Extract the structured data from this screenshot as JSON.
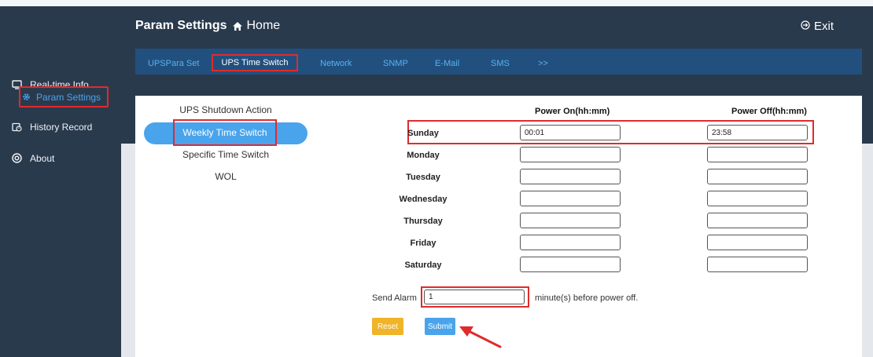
{
  "header": {
    "title": "Param Settings",
    "home_label": "Home",
    "exit_label": "Exit"
  },
  "sidebar": {
    "items": [
      {
        "label": "Real-time Info",
        "icon": "monitor-icon"
      },
      {
        "label": "Param Settings",
        "icon": "gear-icon",
        "active": true
      },
      {
        "label": "History Record",
        "icon": "history-icon"
      },
      {
        "label": "About",
        "icon": "info-circle-icon"
      }
    ]
  },
  "tabs": [
    {
      "label": "UPSPara Set"
    },
    {
      "label": "UPS Time Switch",
      "active": true
    },
    {
      "label": "Network"
    },
    {
      "label": "SNMP"
    },
    {
      "label": "E-Mail"
    },
    {
      "label": "SMS"
    },
    {
      "label": ">>"
    }
  ],
  "submenu": {
    "items": [
      {
        "label": "UPS Shutdown Action"
      },
      {
        "label": "Weekly Time Switch",
        "active": true
      },
      {
        "label": "Specific Time Switch"
      },
      {
        "label": "WOL"
      }
    ]
  },
  "schedule": {
    "col_on": "Power On(hh:mm)",
    "col_off": "Power Off(hh:mm)",
    "days": [
      {
        "day": "Sunday",
        "on": "00:01",
        "off": "23:58"
      },
      {
        "day": "Monday",
        "on": "",
        "off": ""
      },
      {
        "day": "Tuesday",
        "on": "",
        "off": ""
      },
      {
        "day": "Wednesday",
        "on": "",
        "off": ""
      },
      {
        "day": "Thursday",
        "on": "",
        "off": ""
      },
      {
        "day": "Friday",
        "on": "",
        "off": ""
      },
      {
        "day": "Saturday",
        "on": "",
        "off": ""
      }
    ]
  },
  "alarm": {
    "label": "Send Alarm",
    "value": "1",
    "suffix": "minute(s) before power off."
  },
  "buttons": {
    "reset": "Reset",
    "submit": "Submit"
  },
  "colors": {
    "sidebar_bg": "#2a3a4d",
    "tabbar_bg": "#22507e",
    "accent": "#49a4ec",
    "highlight": "#e02b2b",
    "reset_btn": "#f0b429"
  }
}
